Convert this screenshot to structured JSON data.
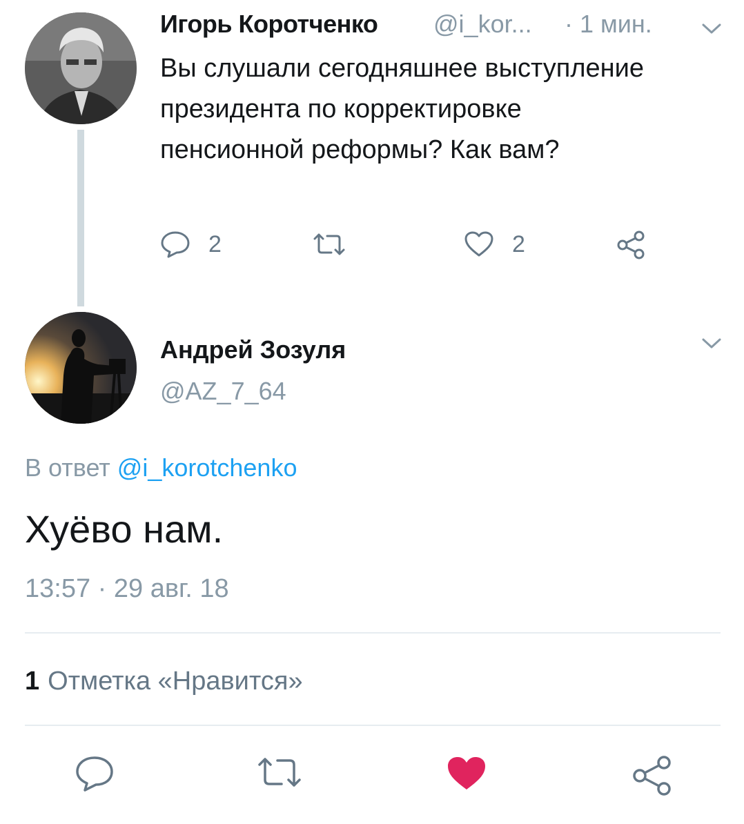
{
  "parent_tweet": {
    "author_name": "Игорь Коротченко",
    "handle": "@i_kor...",
    "time": "· 1 мин.",
    "text": "Вы слушали сегодняшнее выступление президента по корректировке пенсионной реформы? Как вам?",
    "reply_count": "2",
    "like_count": "2",
    "icons": [
      "reply-icon",
      "retweet-icon",
      "like-icon",
      "share-icon",
      "chevron-down-icon"
    ]
  },
  "main_tweet": {
    "author_name": "Андрей Зозуля",
    "handle": "@AZ_7_64",
    "reply_prefix": "В ответ ",
    "reply_mention": "@i_korotchenko",
    "text": "Хуёво нам.",
    "datetime": "13:57 · 29 авг. 18",
    "likes_count": "1",
    "likes_label": "Отметка «Нравится»",
    "liked": true
  },
  "colors": {
    "text": "#14171a",
    "secondary": "#8899a6",
    "icon": "#657786",
    "mention": "#1da1f2",
    "like_active": "#e0245e",
    "thread_line": "#cfd9de",
    "divider": "#e6ecf0"
  }
}
